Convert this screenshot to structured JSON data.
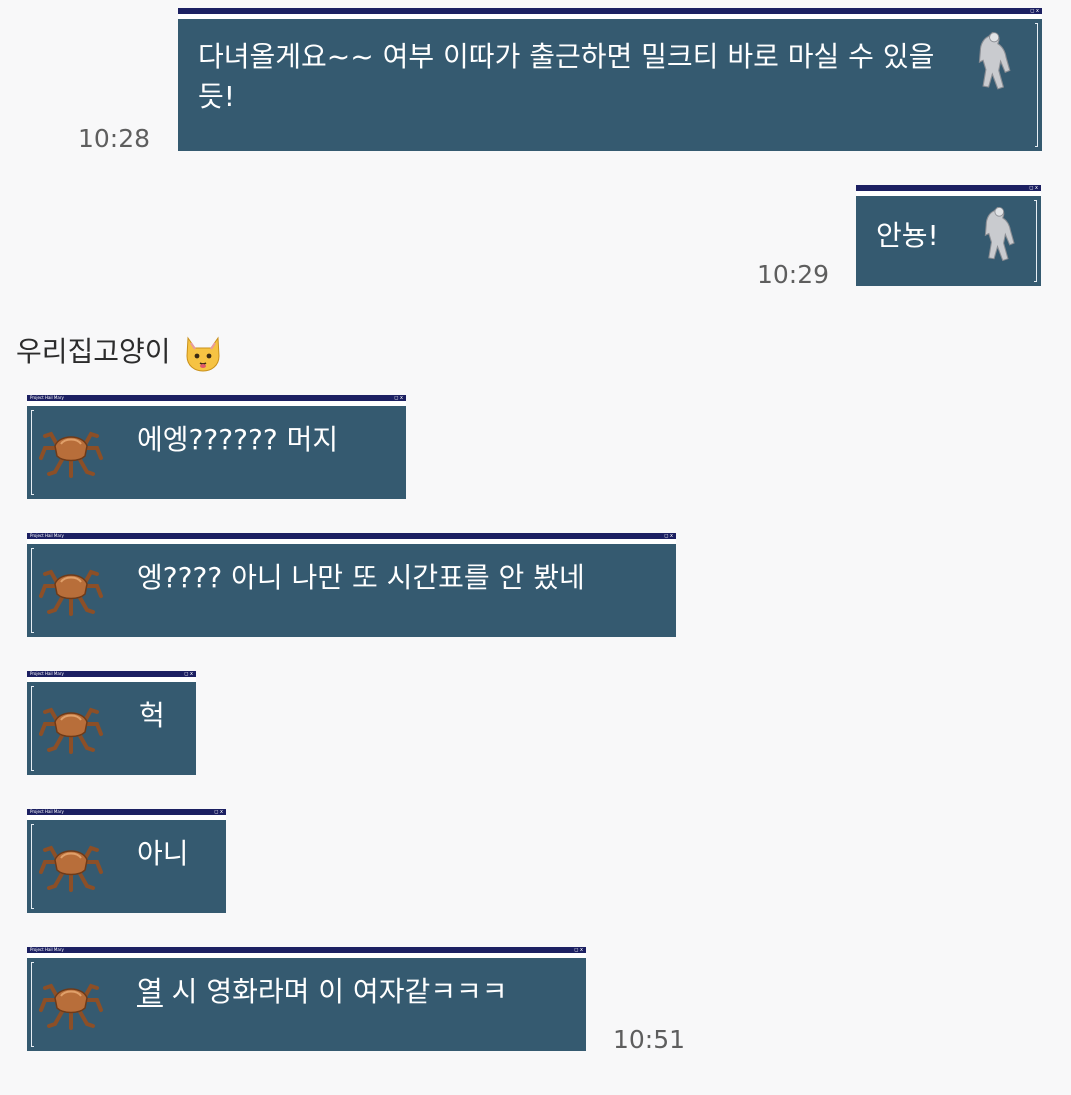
{
  "window_title": "Project Hail Mary",
  "window_controls": "◻ x",
  "colors": {
    "bubble_bg": "#355a70",
    "titlebar": "#1c2062",
    "page_bg": "#f8f8f9"
  },
  "messages": [
    {
      "sender": "me",
      "text": "다녀올게요~~ 여부 이따가 출근하면 밀크티 바로 마실 수 있을 듯!",
      "time": "10:28",
      "icon": "astronaut-silhouette-icon"
    },
    {
      "sender": "me",
      "text": "안뇽!",
      "time": "10:29",
      "icon": "astronaut-silhouette-icon"
    },
    {
      "sender": "other",
      "text": "에엥?????? 머지",
      "icon": "rocky-spider-alien-icon"
    },
    {
      "sender": "other",
      "text": "엥???? 아니 나만 또 시간표를 안 봤네",
      "icon": "rocky-spider-alien-icon"
    },
    {
      "sender": "other",
      "text": "헉",
      "icon": "rocky-spider-alien-icon"
    },
    {
      "sender": "other",
      "text": "아니",
      "icon": "rocky-spider-alien-icon"
    },
    {
      "sender": "other",
      "text_underlined": "열",
      "text_rest": " 시 영화라며 이 여자같ㅋㅋㅋ",
      "time": "10:51",
      "icon": "rocky-spider-alien-icon"
    }
  ],
  "other_sender": {
    "name": "우리집고양이",
    "emoji": "cat-face-emoji-icon"
  }
}
